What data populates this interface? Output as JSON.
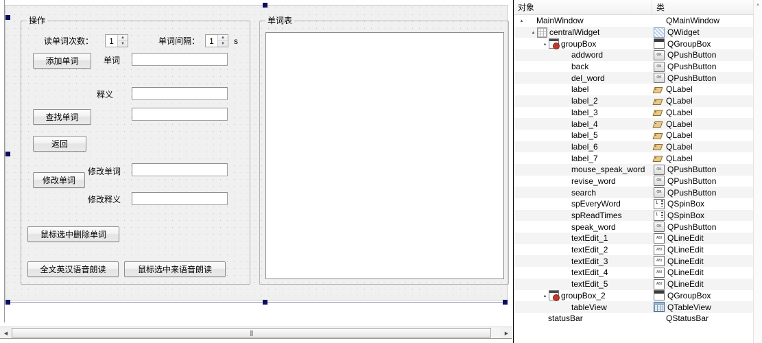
{
  "editor": {
    "groups": [
      {
        "id": "gb-operation",
        "title": "操作"
      },
      {
        "id": "gb-wordlist",
        "title": "单词表"
      }
    ],
    "labels": {
      "read_times": "读单词次数：",
      "word_interval": "单词间隔：",
      "seconds_unit": "s",
      "word": "单词",
      "meaning": "释义",
      "revise_word": "修改单词",
      "revise_meaning": "修改释义"
    },
    "buttons": {
      "add_word": "添加单词",
      "search_word": "查找单词",
      "back": "返回",
      "revise_word": "修改单词",
      "delete_selected": "鼠标选中删除单词",
      "speak_all": "全文英汉语音朗读",
      "speak_selected": "鼠标选中来语音朗读"
    },
    "spinboxes": {
      "read_times_value": "1",
      "word_interval_value": "1",
      "up_arrow": "▲",
      "down_arrow": "▼"
    },
    "lineedits": {
      "word": "",
      "meaning": "",
      "search_result": "",
      "revise_word": "",
      "revise_meaning": ""
    },
    "scrollbar": {
      "left_arrow": "◀",
      "right_arrow": "▶",
      "grip": "|||"
    }
  },
  "inspector": {
    "header": {
      "object_column": "对象",
      "class_column": "类"
    },
    "scroll": {
      "up_arrow": "▲",
      "down_arrow": "▼"
    },
    "rows": [
      {
        "name": "MainWindow",
        "cls": "QMainWindow",
        "depth": 0,
        "expander": "▴",
        "node_icon": "none",
        "cls_icon": "none"
      },
      {
        "name": "centralWidget",
        "cls": "QWidget",
        "depth": 1,
        "expander": "▴",
        "node_icon": "grid",
        "cls_icon": "widget"
      },
      {
        "name": "groupBox",
        "cls": "QGroupBox",
        "depth": 2,
        "expander": "▴",
        "node_icon": "groupbadge",
        "cls_icon": "group"
      },
      {
        "name": "addword",
        "cls": "QPushButton",
        "depth": 3,
        "expander": "",
        "node_icon": "none",
        "cls_icon": "push"
      },
      {
        "name": "back",
        "cls": "QPushButton",
        "depth": 3,
        "expander": "",
        "node_icon": "none",
        "cls_icon": "push"
      },
      {
        "name": "del_word",
        "cls": "QPushButton",
        "depth": 3,
        "expander": "",
        "node_icon": "none",
        "cls_icon": "push"
      },
      {
        "name": "label",
        "cls": "QLabel",
        "depth": 3,
        "expander": "",
        "node_icon": "none",
        "cls_icon": "label"
      },
      {
        "name": "label_2",
        "cls": "QLabel",
        "depth": 3,
        "expander": "",
        "node_icon": "none",
        "cls_icon": "label"
      },
      {
        "name": "label_3",
        "cls": "QLabel",
        "depth": 3,
        "expander": "",
        "node_icon": "none",
        "cls_icon": "label"
      },
      {
        "name": "label_4",
        "cls": "QLabel",
        "depth": 3,
        "expander": "",
        "node_icon": "none",
        "cls_icon": "label"
      },
      {
        "name": "label_5",
        "cls": "QLabel",
        "depth": 3,
        "expander": "",
        "node_icon": "none",
        "cls_icon": "label"
      },
      {
        "name": "label_6",
        "cls": "QLabel",
        "depth": 3,
        "expander": "",
        "node_icon": "none",
        "cls_icon": "label"
      },
      {
        "name": "label_7",
        "cls": "QLabel",
        "depth": 3,
        "expander": "",
        "node_icon": "none",
        "cls_icon": "label"
      },
      {
        "name": "mouse_speak_word",
        "cls": "QPushButton",
        "depth": 3,
        "expander": "",
        "node_icon": "none",
        "cls_icon": "push"
      },
      {
        "name": "revise_word",
        "cls": "QPushButton",
        "depth": 3,
        "expander": "",
        "node_icon": "none",
        "cls_icon": "push"
      },
      {
        "name": "search",
        "cls": "QPushButton",
        "depth": 3,
        "expander": "",
        "node_icon": "none",
        "cls_icon": "push"
      },
      {
        "name": "spEveryWord",
        "cls": "QSpinBox",
        "depth": 3,
        "expander": "",
        "node_icon": "none",
        "cls_icon": "spin"
      },
      {
        "name": "spReadTimes",
        "cls": "QSpinBox",
        "depth": 3,
        "expander": "",
        "node_icon": "none",
        "cls_icon": "spin"
      },
      {
        "name": "speak_word",
        "cls": "QPushButton",
        "depth": 3,
        "expander": "",
        "node_icon": "none",
        "cls_icon": "push"
      },
      {
        "name": "textEdit_1",
        "cls": "QLineEdit",
        "depth": 3,
        "expander": "",
        "node_icon": "none",
        "cls_icon": "line"
      },
      {
        "name": "textEdit_2",
        "cls": "QLineEdit",
        "depth": 3,
        "expander": "",
        "node_icon": "none",
        "cls_icon": "line"
      },
      {
        "name": "textEdit_3",
        "cls": "QLineEdit",
        "depth": 3,
        "expander": "",
        "node_icon": "none",
        "cls_icon": "line"
      },
      {
        "name": "textEdit_4",
        "cls": "QLineEdit",
        "depth": 3,
        "expander": "",
        "node_icon": "none",
        "cls_icon": "line"
      },
      {
        "name": "textEdit_5",
        "cls": "QLineEdit",
        "depth": 3,
        "expander": "",
        "node_icon": "none",
        "cls_icon": "line"
      },
      {
        "name": "groupBox_2",
        "cls": "QGroupBox",
        "depth": 2,
        "expander": "▴",
        "node_icon": "groupbadge",
        "cls_icon": "group"
      },
      {
        "name": "tableView",
        "cls": "QTableView",
        "depth": 3,
        "expander": "",
        "node_icon": "none",
        "cls_icon": "table"
      },
      {
        "name": "statusBar",
        "cls": "QStatusBar",
        "depth": 1,
        "expander": "",
        "node_icon": "none",
        "cls_icon": "none"
      }
    ]
  }
}
